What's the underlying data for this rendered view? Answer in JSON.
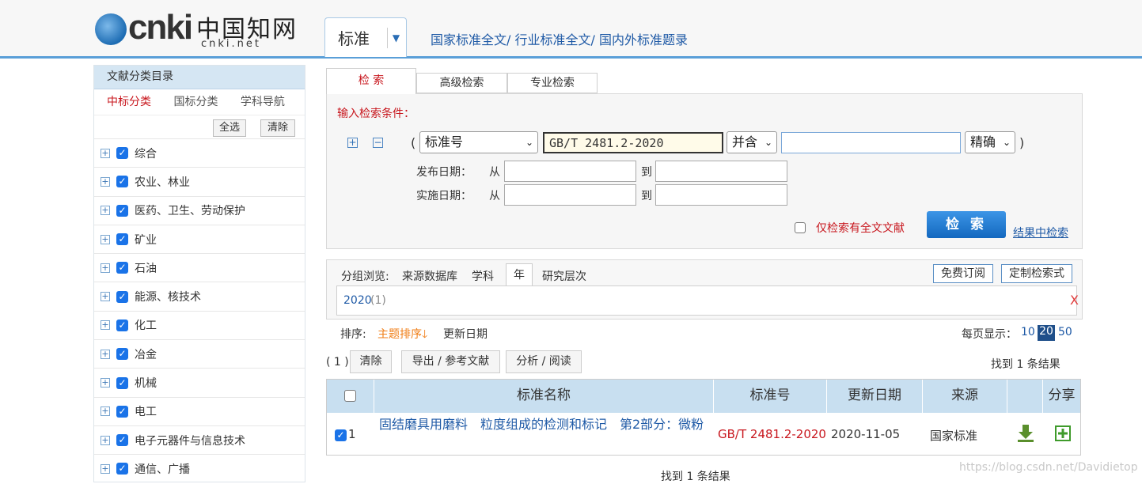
{
  "header": {
    "logo_text": "cnki",
    "logo_zh": "中国知网",
    "logo_net": "cnki.net",
    "db_select": "标准",
    "top_links": "国家标准全文/ 行业标准全文/ 国内外标准题录"
  },
  "sidebar": {
    "title": "文献分类目录",
    "tabs": [
      "中标分类",
      "国标分类",
      "学科导航"
    ],
    "select_all": "全选",
    "clear": "清除",
    "items": [
      "综合",
      "农业、林业",
      "医药、卫生、劳动保护",
      "矿业",
      "石油",
      "能源、核技术",
      "化工",
      "冶金",
      "机械",
      "电工",
      "电子元器件与信息技术",
      "通信、广播"
    ]
  },
  "search_tabs": [
    "检 索",
    "高级检索",
    "专业检索"
  ],
  "search": {
    "label": "输入检索条件：",
    "open_paren": "(",
    "close_paren": ")",
    "field_select": "标准号",
    "field_value": "GB/T 2481.2-2020",
    "logic_select": "并含",
    "second_value": "",
    "match_select": "精确",
    "pub_date_label": "发布日期：",
    "impl_date_label": "实施日期：",
    "from": "从",
    "to": "到",
    "fulltext_only": "仅检索有全文文献",
    "search_button": "检 索",
    "search_in_results": "结果中检索"
  },
  "results": {
    "group_label": "分组浏览:",
    "group_options": [
      "来源数据库",
      "学科",
      "年",
      "研究层次"
    ],
    "subscribe": "免费订阅",
    "custom": "定制检索式",
    "year_value": "2020",
    "year_count": "(1)",
    "close": "X",
    "sort_label": "排序:",
    "sort_topic": "主题排序",
    "sort_date": "更新日期",
    "per_page_label": "每页显示：",
    "per_page": [
      "10",
      "20",
      "50"
    ],
    "selected_count": "( 1 )",
    "clear_btn": "清除",
    "export_btn": "导出 / 参考文献",
    "analyze_btn": "分析 / 阅读",
    "found_top": "找到 1 条结果",
    "found_bottom": "找到 1 条结果"
  },
  "table": {
    "headers": [
      "标准名称",
      "标准号",
      "更新日期",
      "来源",
      "分享"
    ],
    "row": {
      "index": "1",
      "name": "固结磨具用磨料　粒度组成的检测和标记　第2部分：微粉",
      "number": "GB/T 2481.2-2020",
      "date": "2020-11-05",
      "source": "国家标准"
    }
  },
  "watermark": "https://blog.csdn.net/Davidietop",
  "colors": {
    "accent_red": "#c8171e",
    "link_blue": "#1f5aa6",
    "header_blue": "#c8dff0"
  }
}
